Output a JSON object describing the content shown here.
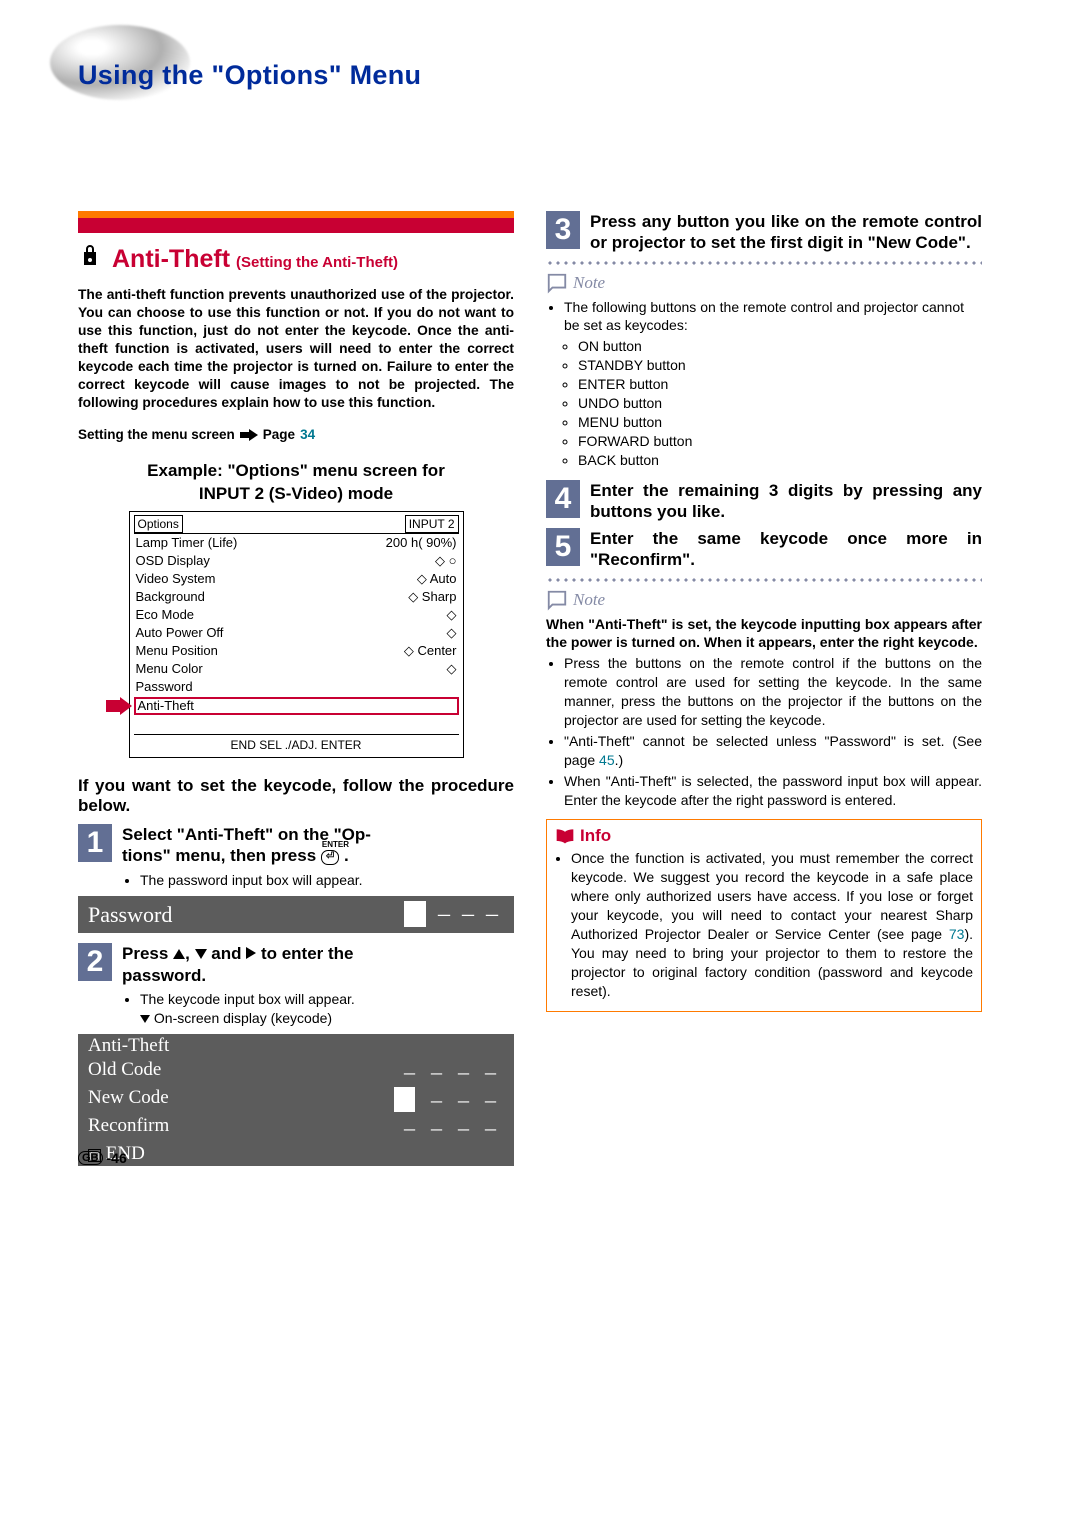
{
  "page_title": "Using the \"Options\" Menu",
  "section": {
    "main": "Anti-Theft",
    "sub": "(Setting the Anti-Theft)"
  },
  "intro": "The anti-theft function prevents unauthorized use of the projector. You can choose to use this function or not. If you do not want to use this function, just do not enter the keycode. Once the anti-theft function is activated, users will need to enter the correct keycode each time the projector is turned on. Failure to enter the correct keycode will cause images to not be projected. The following procedures explain how to use this function.",
  "setting_line": {
    "text": "Setting the menu screen",
    "page_label": "Page",
    "page_num": "34"
  },
  "example_hdr1": "Example: \"Options\" menu screen for",
  "example_hdr2": "INPUT 2 (S-Video) mode",
  "menu": {
    "top_left": "Options",
    "top_right": "INPUT 2",
    "rows": [
      {
        "l": "Lamp Timer (Life)",
        "r": "200 h(    90%)"
      },
      {
        "l": "OSD Display",
        "r": "◇ ○"
      },
      {
        "l": "Video System",
        "r": "◇ Auto"
      },
      {
        "l": "Background",
        "r": "◇ Sharp"
      },
      {
        "l": "Eco Mode",
        "r": "◇"
      },
      {
        "l": "Auto Power Off",
        "r": "◇"
      },
      {
        "l": "Menu Position",
        "r": "◇ Center"
      },
      {
        "l": "Menu Color",
        "r": "◇"
      },
      {
        "l": "Password",
        "r": ""
      },
      {
        "l": "Anti-Theft",
        "r": ""
      }
    ],
    "foot": "END  SEL ./ADJ. ENTER"
  },
  "procedure_text": "If you want to set the keycode, follow the procedure below.",
  "steps": {
    "s1": {
      "num": "1",
      "title_a": "Select \"Anti-Theft\" on the \"Op-",
      "title_b": "tions\" menu, then press",
      "bullet": "The password input box will appear."
    },
    "s2": {
      "num": "2",
      "title_a": "Press",
      "title_b": "and",
      "title_c": "to enter the",
      "title_d": "password.",
      "b1": "The keycode input box will appear.",
      "b2": "On-screen display (keycode)"
    },
    "s3": {
      "num": "3",
      "text": "Press any button you like on the remote control or projector to set the first digit in \"New Code\"."
    },
    "s4": {
      "num": "4",
      "text": "Enter the remaining 3 digits by pressing any buttons you like."
    },
    "s5": {
      "num": "5",
      "text": "Enter the same keycode once more in \"Reconfirm\"."
    }
  },
  "pwd_label": "Password",
  "anti_table": {
    "title": "Anti-Theft",
    "r1": "Old Code",
    "r2": "New Code",
    "r3": "Reconfirm",
    "end": "END"
  },
  "note_label": "Note",
  "note1": {
    "lead": "The following buttons on the remote control and projector cannot be set as keycodes:",
    "items": [
      "ON button",
      "STANDBY button",
      "ENTER button",
      "UNDO button",
      "MENU button",
      "FORWARD button",
      "BACK button"
    ]
  },
  "note2": {
    "bold": "When \"Anti-Theft\" is set, the keycode inputting box appears after the power is turned on. When it appears, enter the right keycode.",
    "b1": "Press the buttons on the remote control if the buttons on the remote control are used for setting the keycode. In the same manner, press the buttons on the projector if the buttons on the projector are used for setting the keycode.",
    "b2a": "\"Anti-Theft\" cannot be selected unless \"Password\" is set. (See page ",
    "b2_pg": "45",
    "b2b": ".)",
    "b3": "When \"Anti-Theft\" is selected, the password input box will appear. Enter the keycode after the right password is entered."
  },
  "info": {
    "label": "Info",
    "text_a": "Once the function is activated, you must remember the correct keycode. We suggest you record the keycode in a safe place where only authorized users have access. If you lose or forget your keycode, you will need to contact your nearest Sharp Authorized Projector Dealer or Service Center (see page ",
    "pg": "73",
    "text_b": "). You may need to bring your projector to them to restore the projector to original factory condition (password and keycode reset)."
  },
  "page_num_label_a": "GB",
  "page_num_label_b": "-46"
}
